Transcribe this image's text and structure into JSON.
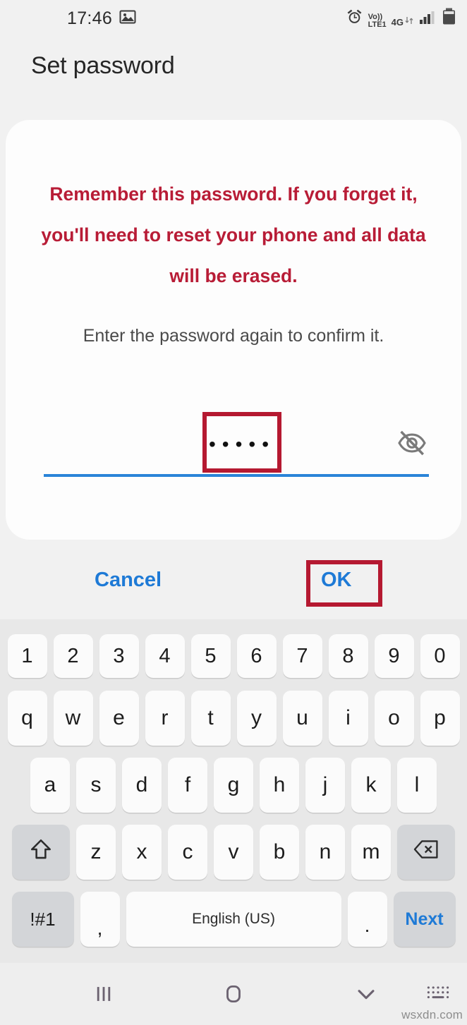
{
  "status_bar": {
    "clock": "17:46",
    "left_icons": [
      "image-icon"
    ],
    "right_icons": [
      "alarm-icon",
      "volte-icon",
      "4g-icon",
      "data-transfer-icon",
      "signal-bars-icon",
      "battery-icon"
    ],
    "volte_top": "Vo))",
    "volte_bottom": "LTE1",
    "network": "4G"
  },
  "header": {
    "title": "Set password"
  },
  "dialog": {
    "warning": "Remember this password. If you forget it, you'll need to reset your phone and all data will be erased.",
    "warning_color": "#b81c36",
    "instruction": "Enter the password again to confirm it.",
    "password_field": {
      "value": "•••••",
      "char_count": 5,
      "placeholder": "",
      "underline_color": "#2a84d8",
      "reveal_icon": "eye-off-icon"
    },
    "buttons": {
      "cancel_label": "Cancel",
      "ok_label": "OK",
      "button_color": "#1e7ad6"
    }
  },
  "annotations": {
    "color": "#b51931",
    "boxes": [
      "password-field-highlight",
      "ok-button-highlight"
    ]
  },
  "keyboard": {
    "row_numbers": [
      "1",
      "2",
      "3",
      "4",
      "5",
      "6",
      "7",
      "8",
      "9",
      "0"
    ],
    "row_q": [
      "q",
      "w",
      "e",
      "r",
      "t",
      "y",
      "u",
      "i",
      "o",
      "p"
    ],
    "row_a": [
      "a",
      "s",
      "d",
      "f",
      "g",
      "h",
      "j",
      "k",
      "l"
    ],
    "row_z": [
      "z",
      "x",
      "c",
      "v",
      "b",
      "n",
      "m"
    ],
    "shift_icon": "shift-arrow-icon",
    "backspace_icon": "backspace-icon",
    "symbols_label": "!#1",
    "comma_label": ",",
    "space_label": "English (US)",
    "period_label": ".",
    "next_label": "Next",
    "next_color": "#1e7ad6"
  },
  "navigation": {
    "recent_label": "recent-apps",
    "home_label": "home",
    "hide_keyboard_label": "hide-keyboard",
    "keyboard_switch_label": "keyboard-switcher"
  },
  "watermark": "wsxdn.com"
}
